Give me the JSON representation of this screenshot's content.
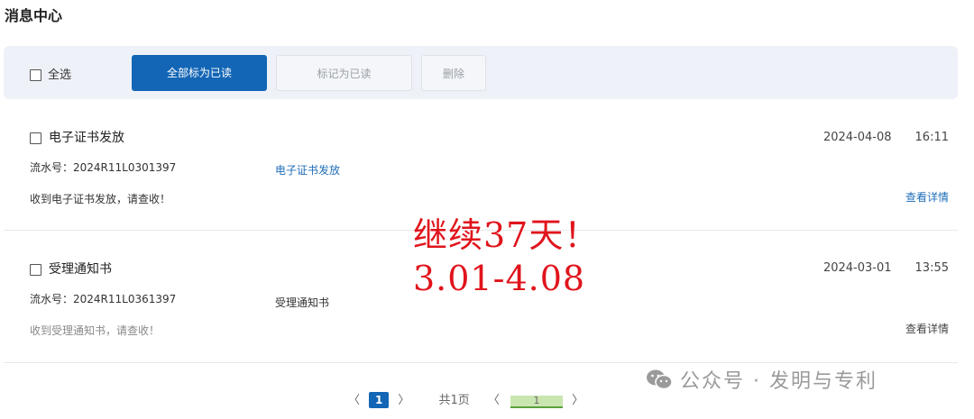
{
  "page": {
    "title": "消息中心"
  },
  "toolbar": {
    "select_all": "全选",
    "mark_all_read": "全部标为已读",
    "mark_read": "标记为已读",
    "delete": "删除"
  },
  "messages": [
    {
      "title": "电子证书发放",
      "serial": "流水号：2024R11L0301397",
      "category": "电子证书发放",
      "summary": "收到电子证书发放，请查收！",
      "date": "2024-04-08",
      "time": "16:11",
      "detail": "查看详情"
    },
    {
      "title": "受理通知书",
      "serial": "流水号：2024R11L0361397",
      "category": "受理通知书",
      "summary": "收到受理通知书，请查收！",
      "date": "2024-03-01",
      "time": "13:55",
      "detail": "查看详情"
    }
  ],
  "overlay": {
    "line1": "继续37天！",
    "line2": "3.01-4.08"
  },
  "pagination": {
    "prev": "〈",
    "current": "1",
    "next": "〉",
    "total": "共1页",
    "jump_prev": "〈",
    "jump_value": "1",
    "jump_next": "〉"
  },
  "watermark": {
    "text": "公众号 · 发明与专利",
    "icon": "wechat-icon"
  },
  "colors": {
    "primary": "#1366b5",
    "link": "#1f6db8",
    "overlay": "#e0141c",
    "toolbar_bg": "#eef2f8"
  }
}
